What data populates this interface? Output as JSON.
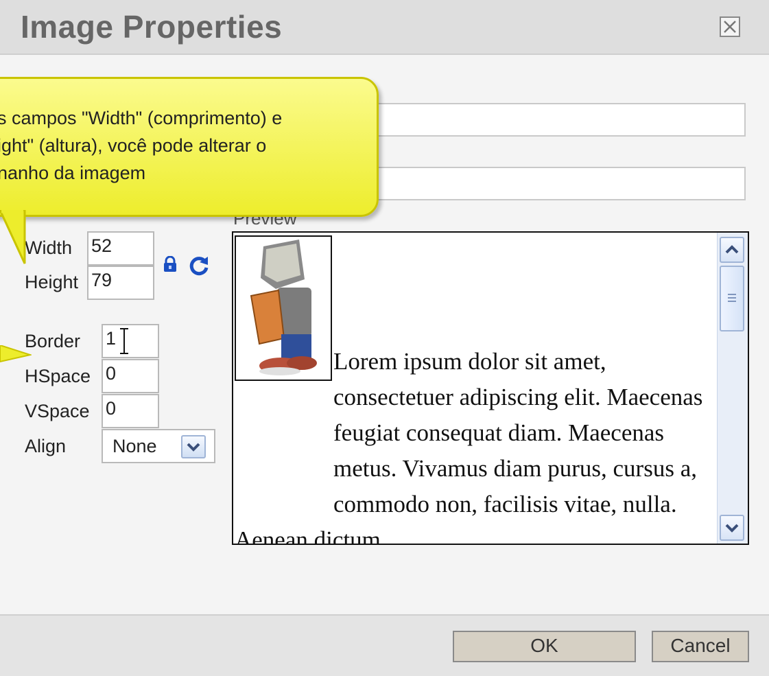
{
  "dialog": {
    "title": "Image Properties",
    "preview_label": "Preview"
  },
  "tooltip": {
    "text": "s campos \"Width\" (comprimento) e\night\" (altura), você pode alterar o\nnanho da imagem"
  },
  "fields": {
    "url": {
      "value": ""
    },
    "alt": {
      "value": ""
    },
    "width": {
      "label": "Width",
      "value": "52"
    },
    "height": {
      "label": "Height",
      "value": "79"
    },
    "border": {
      "label": "Border",
      "value": "1"
    },
    "hspace": {
      "label": "HSpace",
      "value": "0"
    },
    "vspace": {
      "label": "VSpace",
      "value": "0"
    },
    "align": {
      "label": "Align",
      "value": "None"
    }
  },
  "preview": {
    "text": "Lorem ipsum dolor sit amet, consectetuer adipiscing elit. Maecenas feugiat consequat diam. Maecenas metus. Vivamus diam purus, cursus a, commodo non, facilisis vitae, nulla. Aenean dictum"
  },
  "buttons": {
    "ok": "OK",
    "cancel": "Cancel"
  },
  "icons": {
    "close": "close-icon",
    "lock": "lock-icon",
    "reset": "reset-size-icon",
    "scroll_up": "chevron-up-icon",
    "scroll_down": "chevron-down-icon",
    "dropdown": "chevron-down-icon"
  },
  "colors": {
    "tooltip_fill": "#f4f45a",
    "tooltip_border": "#c9c400",
    "lock_icon": "#1a4fc2"
  }
}
